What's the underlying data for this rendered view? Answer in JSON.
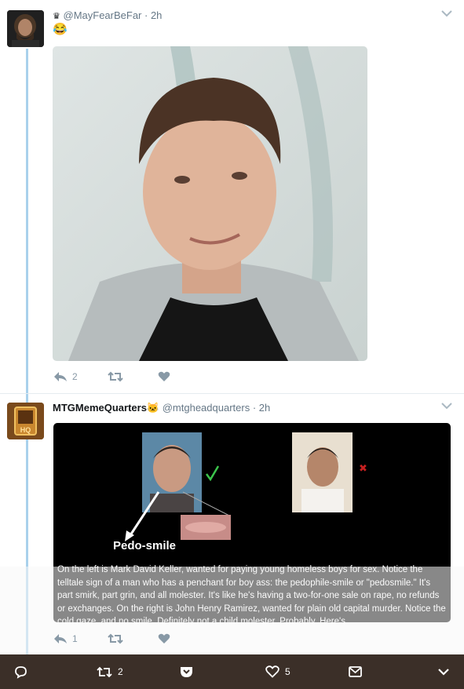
{
  "tweet1": {
    "handle": "@MayFearBeFar",
    "time": "· 2h",
    "emoji": "😂",
    "actions": {
      "reply_count": "2",
      "retweet_count": "",
      "like_count": ""
    }
  },
  "tweet2": {
    "name": "MTGMemeQuarters",
    "name_emoji": "🐱",
    "handle": "@mtgheadquarters",
    "time": "· 2h",
    "avatar_text": "HQ",
    "image": {
      "pedo_label": "Pedo-smile",
      "caption": "On the left is Mark David Keller, wanted for paying young homeless boys for sex. Notice the telltale sign of a man who has a penchant for boy ass: the pedophile-smile or \"pedosmile.\" It's part smirk, part grin, and all molester. It's like he's having a two-for-one sale on rape, no refunds or exchanges. On the right is John Henry Ramirez, wanted for plain old capital murder. Notice the cold gaze, and no smile. Definitely not a child molester. Probably. Here's"
    },
    "actions": {
      "reply_count": "1",
      "retweet_count": "",
      "like_count": ""
    }
  },
  "bottom_bar": {
    "retweet_count": "2",
    "like_count": "5"
  },
  "colors": {
    "bar": "#3b2f28",
    "thread": "#a9d1ec",
    "action": "#8899a6"
  }
}
